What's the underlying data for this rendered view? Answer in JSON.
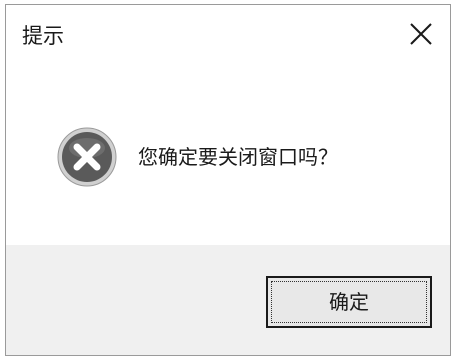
{
  "dialog": {
    "title": "提示",
    "message": "您确定要关闭窗口吗？",
    "ok_label": "确定",
    "icon": "error-icon"
  },
  "colors": {
    "error_icon_fill": "#5a5a5a",
    "footer_bg": "#f0f0f0",
    "button_bg": "#e8e8e8"
  }
}
